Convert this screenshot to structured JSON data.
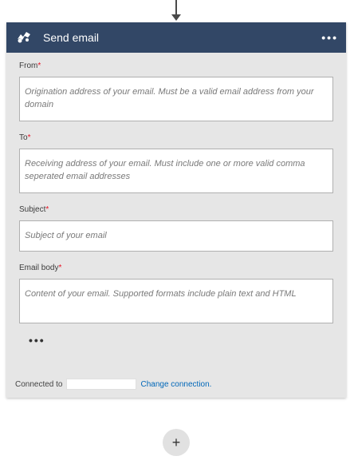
{
  "header": {
    "title": "Send email",
    "icon": "email-service-icon",
    "menu_label": "•••"
  },
  "fields": {
    "from": {
      "label": "From",
      "required_mark": "*",
      "placeholder": "Origination address of your email. Must be a valid email address from your domain"
    },
    "to": {
      "label": "To",
      "required_mark": "*",
      "placeholder": "Receiving address of your email. Must include one or more valid comma seperated email addresses"
    },
    "subject": {
      "label": "Subject",
      "required_mark": "*",
      "placeholder": "Subject of your email"
    },
    "body": {
      "label": "Email body",
      "required_mark": "*",
      "placeholder": "Content of your email. Supported formats include plain text and HTML"
    }
  },
  "more_options_label": "•••",
  "footer": {
    "connected_label": "Connected to",
    "change_link": "Change connection."
  },
  "add_step_label": "+",
  "colors": {
    "header_bg": "#324766",
    "card_bg": "#e6e6e6",
    "required": "#e81123",
    "link": "#0067b8"
  }
}
